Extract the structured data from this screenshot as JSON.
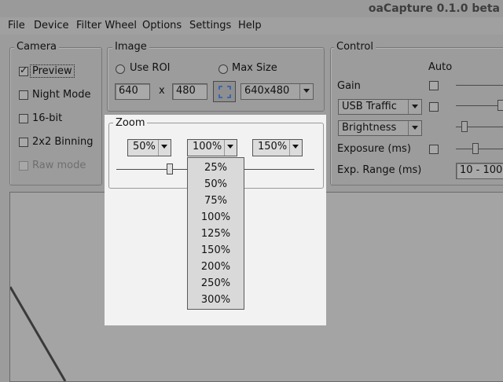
{
  "window": {
    "title": "oaCapture 0.1.0 beta"
  },
  "menu": [
    "File",
    "Device",
    "Filter Wheel",
    "Options",
    "Settings",
    "Help"
  ],
  "camera": {
    "title": "Camera",
    "preview": {
      "label": "Preview",
      "checked": true
    },
    "night_mode": {
      "label": "Night Mode",
      "checked": false
    },
    "bit16": {
      "label": "16-bit",
      "checked": false
    },
    "binning": {
      "label": "2x2 Binning",
      "checked": false
    },
    "raw_mode": {
      "label": "Raw mode",
      "checked": false,
      "enabled": false
    }
  },
  "image": {
    "title": "Image",
    "use_roi_label": "Use ROI",
    "max_size_label": "Max Size",
    "width": "640",
    "x_label": "x",
    "height": "480",
    "resolution": "640x480"
  },
  "zoom": {
    "title": "Zoom",
    "buttons": [
      "50%",
      "100%",
      "150%"
    ],
    "slider_fraction": 0.27,
    "options": [
      "25%",
      "50%",
      "75%",
      "100%",
      "125%",
      "150%",
      "200%",
      "250%",
      "300%"
    ]
  },
  "control": {
    "title": "Control",
    "auto_label": "Auto",
    "gain_label": "Gain",
    "usb_traffic": "USB Traffic",
    "brightness": "Brightness",
    "exposure_label": "Exposure (ms)",
    "exp_range_label": "Exp. Range (ms)",
    "exp_range_value": "10 - 100"
  }
}
